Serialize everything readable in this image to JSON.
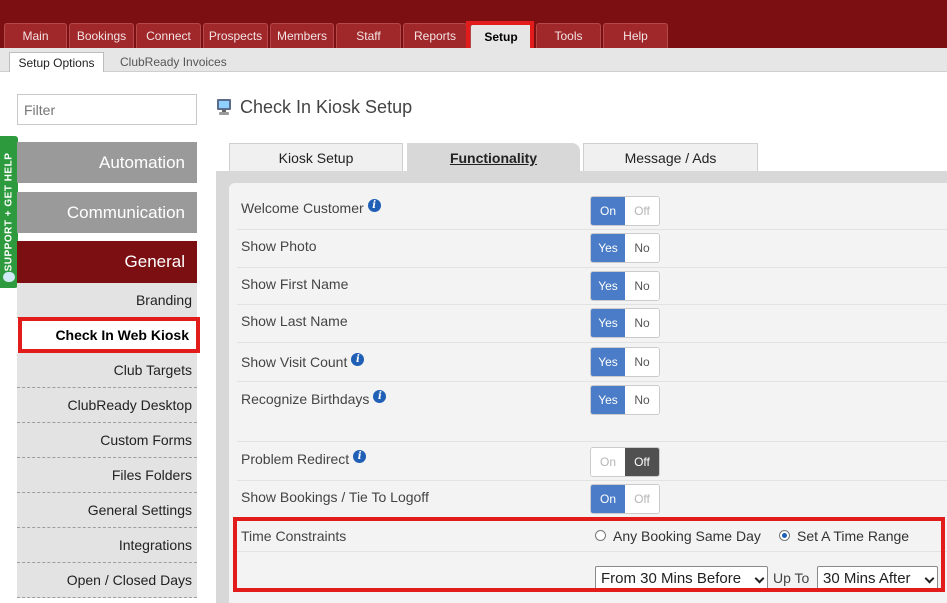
{
  "topnav": {
    "tabs": [
      {
        "label": "Main"
      },
      {
        "label": "Bookings"
      },
      {
        "label": "Connect"
      },
      {
        "label": "Prospects"
      },
      {
        "label": "Members"
      },
      {
        "label": "Staff"
      },
      {
        "label": "Reports"
      },
      {
        "label": "Setup"
      },
      {
        "label": "Tools"
      },
      {
        "label": "Help"
      }
    ],
    "active": "Setup"
  },
  "subnav": {
    "tabs": [
      {
        "label": "Setup Options"
      },
      {
        "label": "ClubReady Invoices"
      }
    ]
  },
  "sidebar": {
    "filter_placeholder": "Filter",
    "support_label": "SUPPORT + GET HELP",
    "categories": [
      {
        "label": "Automation"
      },
      {
        "label": "Communication"
      },
      {
        "label": "General"
      }
    ],
    "items": [
      {
        "label": "Branding"
      },
      {
        "label": "Check In Web Kiosk"
      },
      {
        "label": "Club Targets"
      },
      {
        "label": "ClubReady Desktop"
      },
      {
        "label": "Custom Forms"
      },
      {
        "label": "Files Folders"
      },
      {
        "label": "General Settings"
      },
      {
        "label": "Integrations"
      },
      {
        "label": "Open / Closed Days"
      }
    ]
  },
  "page": {
    "title": "Check In Kiosk Setup",
    "icon": "kiosk-computer-icon"
  },
  "content_tabs": [
    {
      "label": "Kiosk Setup"
    },
    {
      "label": "Functionality"
    },
    {
      "label": "Message / Ads"
    }
  ],
  "settings": [
    {
      "label": "Welcome Customer",
      "on": "On",
      "off": "Off"
    },
    {
      "label": "Show Photo",
      "on": "Yes",
      "off": "No"
    },
    {
      "label": "Show First Name",
      "on": "Yes",
      "off": "No"
    },
    {
      "label": "Show Last Name",
      "on": "Yes",
      "off": "No"
    },
    {
      "label": "Show Visit Count",
      "on": "Yes",
      "off": "No"
    },
    {
      "label": "Recognize Birthdays",
      "on": "Yes",
      "off": "No"
    },
    {
      "label": "Problem Redirect",
      "on": "On",
      "off": "Off"
    },
    {
      "label": "Show Bookings / Tie To Logoff",
      "on": "On",
      "off": "Off"
    }
  ],
  "info_glyph": "i",
  "time_constraints": {
    "label": "Time Constraints",
    "option_any": "Any Booking Same Day",
    "option_range": "Set A Time Range",
    "from_value": "From 30 Mins Before",
    "up_to": "Up To",
    "to_value": "30 Mins After"
  },
  "colors": {
    "brand": "#7c0f12",
    "toggle_on": "#4a7cc7",
    "toggle_off_active": "#505050",
    "highlight": "#e21b1b",
    "support": "#2e9a3e"
  }
}
